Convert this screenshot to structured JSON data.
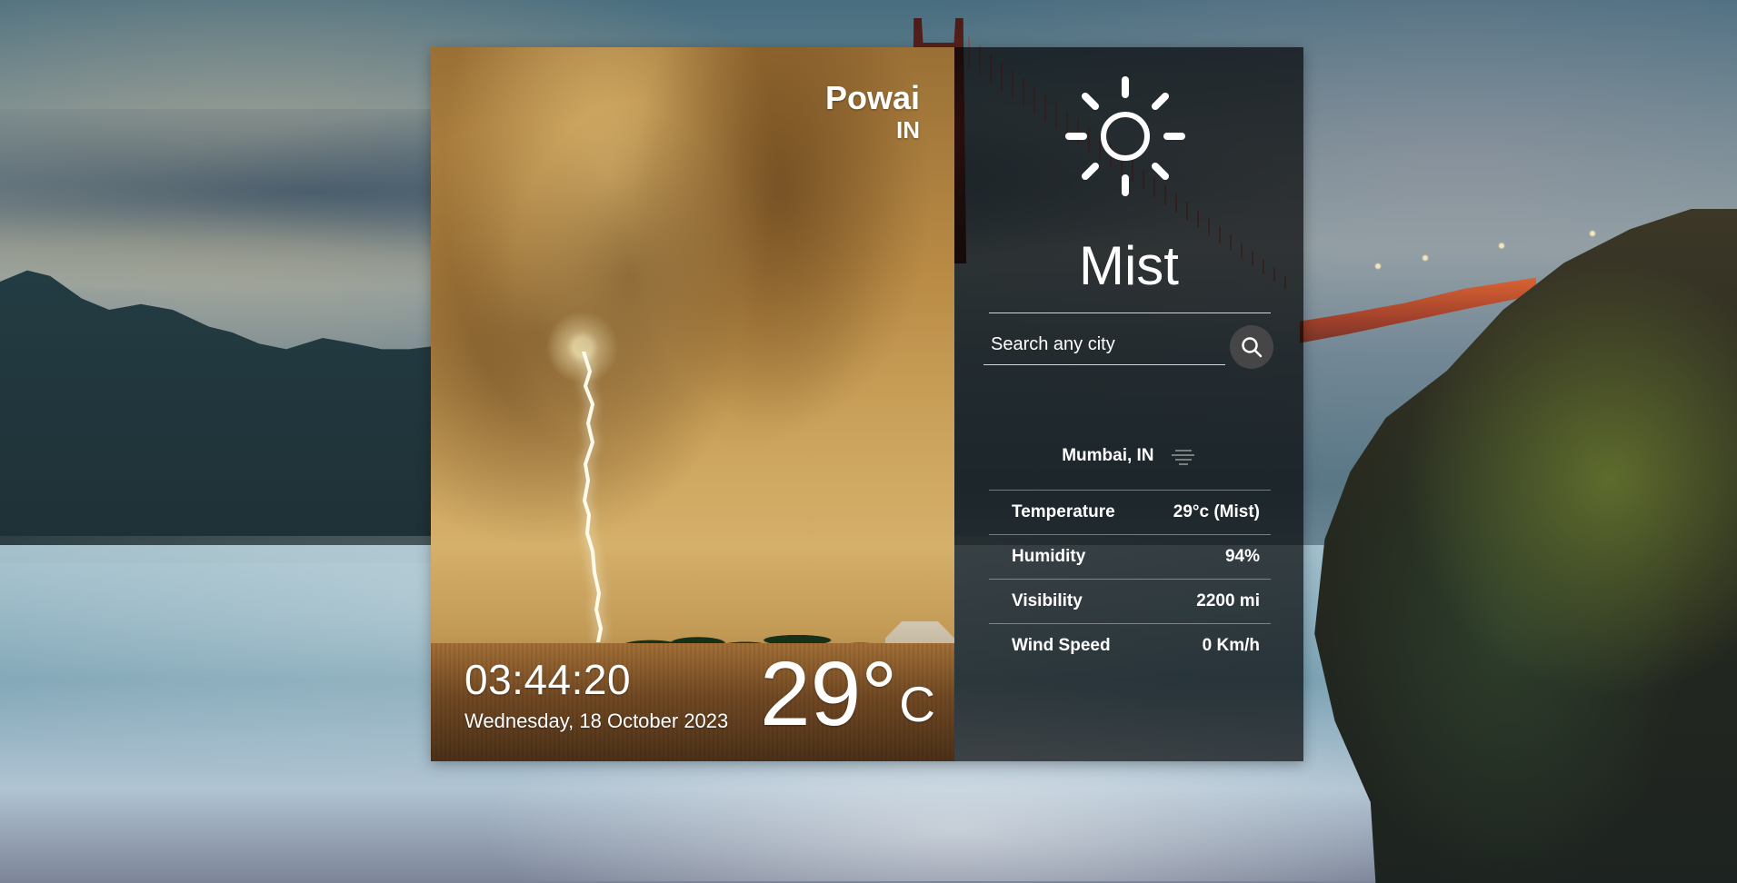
{
  "left_panel": {
    "city": "Powai",
    "country": "IN",
    "time": "03:44:20",
    "date": "Wednesday, 18 October 2023",
    "temperature": "29°",
    "unit": "C"
  },
  "right_panel": {
    "weather_icon": "sun-icon",
    "condition": "Mist",
    "search": {
      "placeholder": "Search any city",
      "value": "",
      "button_icon": "search-icon"
    },
    "location": "Mumbai, IN",
    "location_icon": "mist-icon",
    "stats": [
      {
        "label": "Temperature",
        "value": "29°c (Mist)"
      },
      {
        "label": "Humidity",
        "value": "94%"
      },
      {
        "label": "Visibility",
        "value": "2200 mi"
      },
      {
        "label": "Wind Speed",
        "value": "0 Km/h"
      }
    ]
  },
  "colors": {
    "text_primary": "#ffffff",
    "panel_dark_overlay": "#000000",
    "search_button_bg": "#484848",
    "left_panel_tone": "#caa15a"
  }
}
